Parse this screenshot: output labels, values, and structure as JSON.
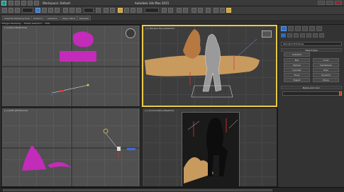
{
  "titlebar": {
    "workspace": "Workspace: Default",
    "title": "Autodesk 3ds Max 2015"
  },
  "ribbon": {
    "tabs": [
      "Graphite Modeling Tools",
      "Freeform",
      "Selection",
      "Object Paint",
      "Populate"
    ]
  },
  "subribbon": {
    "items": [
      "Polygon Modeling",
      "Modify Selection",
      "Edit"
    ]
  },
  "viewports": {
    "top": {
      "label": "[+] [Top] [Wireframe]"
    },
    "perspective": {
      "label": "[+] [Perspective] [Realistic]"
    },
    "left": {
      "label": "[+] [Left] [Wireframe]"
    },
    "camera": {
      "label": "[+] [Camera001] [Realistic]"
    }
  },
  "command_panel": {
    "dropdown": "Standard Primitives",
    "object_type": "Object Type",
    "autogrid": "AutoGrid",
    "buttons": [
      "Box",
      "Cone",
      "Sphere",
      "GeoSphere",
      "Cylinder",
      "Tube",
      "Torus",
      "Pyramid",
      "Teapot",
      "Plane"
    ],
    "name_color": "Name and Color"
  },
  "colors": {
    "viewport_bg": "#505050",
    "active_border": "#e6c84a",
    "magenta": "#c32bb9",
    "sand": "#c89a5e"
  }
}
